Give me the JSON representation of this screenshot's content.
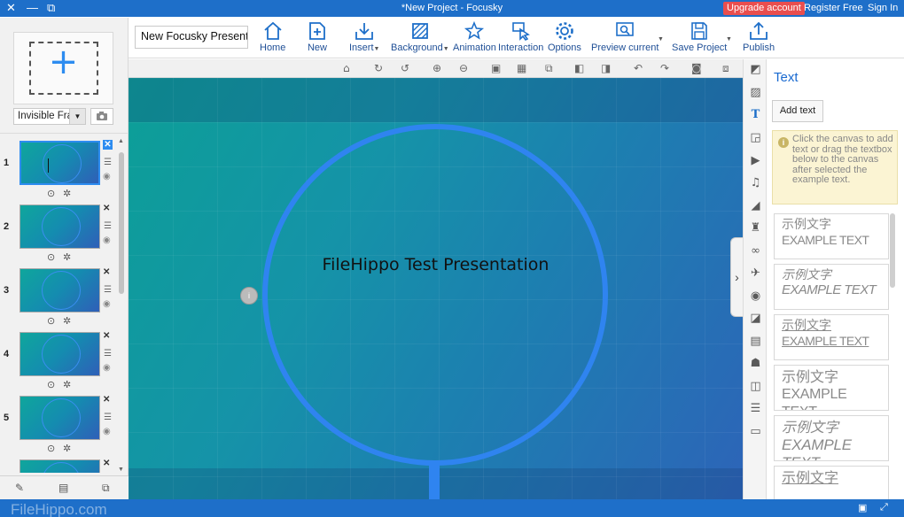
{
  "window": {
    "title": "*New Project - Focusky",
    "close_glyph": "✕",
    "minimize_glyph": "—",
    "restore_glyph": "⧉",
    "upgrade_label": "Upgrade account",
    "register_label": "Register Free",
    "signin_label": "Sign In"
  },
  "toolbar": {
    "project_name": "New Focusky Presentation",
    "buttons": [
      {
        "label": "Home",
        "icon": "home-icon"
      },
      {
        "label": "New",
        "icon": "new-icon"
      },
      {
        "label": "Insert",
        "icon": "insert-icon",
        "dropdown": true
      },
      {
        "label": "Background",
        "icon": "background-icon",
        "dropdown": true
      },
      {
        "label": "Animation",
        "icon": "animation-icon"
      },
      {
        "label": "Interaction",
        "icon": "interaction-icon"
      },
      {
        "label": "Options",
        "icon": "options-icon"
      },
      {
        "label": "Preview current",
        "icon": "preview-icon",
        "dropdown": true
      },
      {
        "label": "Save Project",
        "icon": "save-icon",
        "dropdown": true
      },
      {
        "label": "Publish",
        "icon": "publish-icon"
      }
    ]
  },
  "left_panel": {
    "add_frame_glyph": "+",
    "frame_type": "Invisible Frame",
    "slides": [
      {
        "number": "1",
        "active": true
      },
      {
        "number": "2",
        "active": false
      },
      {
        "number": "3",
        "active": false
      },
      {
        "number": "4",
        "active": false
      },
      {
        "number": "5",
        "active": false
      },
      {
        "number": "",
        "active": false
      }
    ]
  },
  "canvas": {
    "text": "FileHippo Test Presentation",
    "handle_glyph": "i",
    "collapse_glyph": "›"
  },
  "right_panel": {
    "title": "Text",
    "add_text_label": "Add text",
    "tip": "Click the canvas to add text or drag the textbox below to the canvas after selected the example text.",
    "examples": [
      {
        "cn": "示例文字",
        "en": "EXAMPLE TEXT",
        "style": "plain"
      },
      {
        "cn": "示例文字",
        "en": "EXAMPLE TEXT",
        "style": "italic"
      },
      {
        "cn": "示例文字",
        "en": "EXAMPLE TEXT",
        "style": "underline"
      },
      {
        "cn": "示例文字",
        "en": "EXAMPLE TEXT",
        "style": "large"
      },
      {
        "cn": "示例文字",
        "en": "EXAMPLE TEXT",
        "style": "large-italic"
      },
      {
        "cn": "示例文字",
        "en": "",
        "style": "underline"
      }
    ]
  },
  "status": {
    "watermark": "FileHippo.com"
  },
  "colors": {
    "accent": "#1e6fc9",
    "upgrade": "#e94e4e",
    "ring": "#2f84f0"
  }
}
